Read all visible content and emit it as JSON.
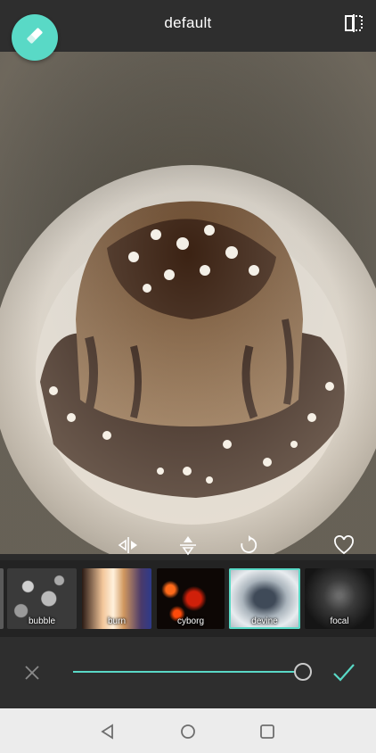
{
  "header": {
    "title": "default",
    "eraser_icon": "eraser-icon",
    "compare_icon": "compare-split-icon"
  },
  "photo_tools": {
    "icons": [
      "flip-horizontal-icon",
      "flip-vertical-icon",
      "rotate-icon",
      "favorite-heart-icon"
    ]
  },
  "effects": {
    "items": [
      {
        "label": ""
      },
      {
        "label": "bubble"
      },
      {
        "label": "burn"
      },
      {
        "label": "cyborg"
      },
      {
        "label": "devine"
      },
      {
        "label": "focal"
      }
    ],
    "selected": "devine"
  },
  "controls": {
    "cancel_icon": "close-icon",
    "apply_icon": "check-icon",
    "intensity": 1.0
  },
  "nav": {
    "icons": [
      "back-triangle-icon",
      "home-circle-icon",
      "recents-square-icon"
    ]
  },
  "colors": {
    "accent": "#59d9c6",
    "bar": "#2e2e2e",
    "strip": "#232323"
  }
}
